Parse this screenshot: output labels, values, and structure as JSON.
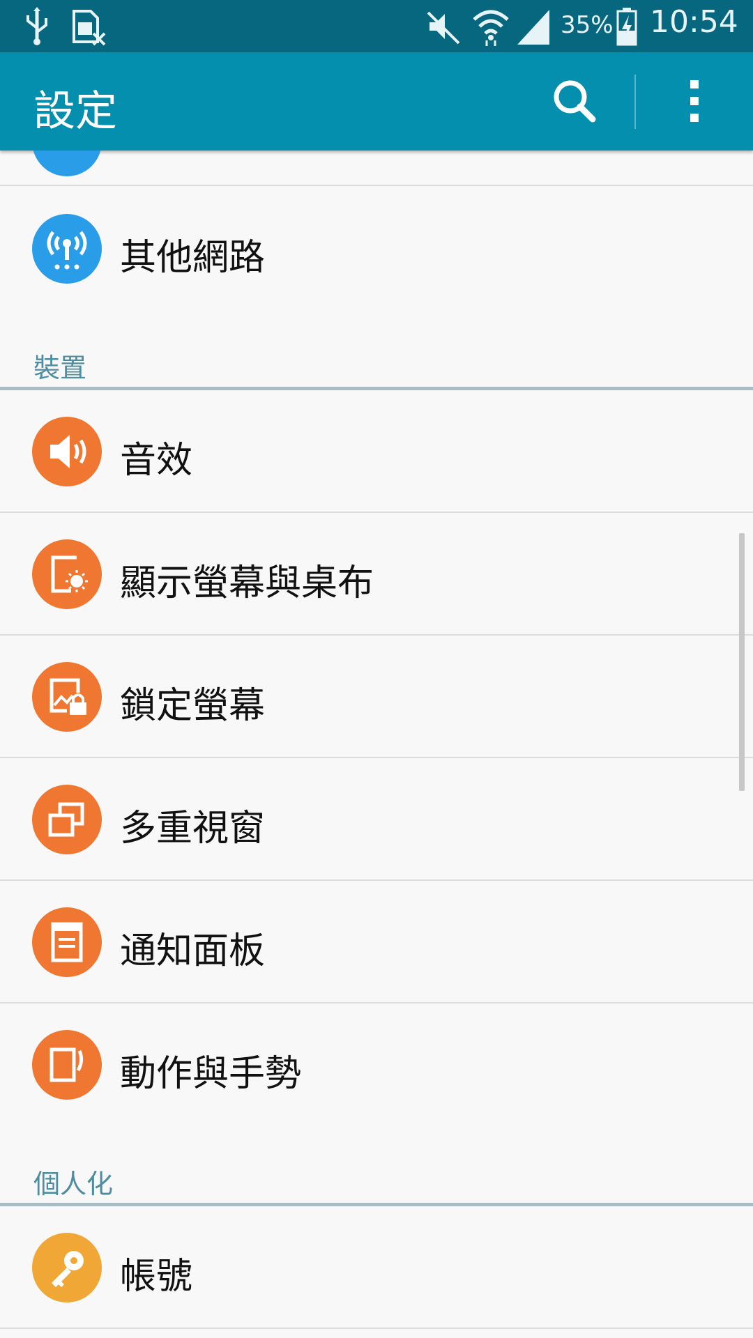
{
  "status_bar": {
    "battery_percent": "35%",
    "time": "10:54",
    "icons": [
      "usb-icon",
      "sim-card-off-icon",
      "mute-icon",
      "wifi-icon",
      "cell-signal-icon",
      "battery-charging-icon"
    ]
  },
  "app_bar": {
    "title": "設定",
    "icons": [
      "search-icon",
      "more-options-icon"
    ]
  },
  "list": {
    "rows_top": [
      {
        "label": "其他網路",
        "icon": "wireless-network-icon",
        "color": "#2a9de8"
      }
    ],
    "sections": [
      {
        "title": "裝置",
        "items": [
          {
            "label": "音效",
            "icon": "speaker-icon",
            "color": "#ef7732"
          },
          {
            "label": "顯示螢幕與桌布",
            "icon": "display-brightness-icon",
            "color": "#ef7732"
          },
          {
            "label": "鎖定螢幕",
            "icon": "lock-screen-icon",
            "color": "#ef7732"
          },
          {
            "label": "多重視窗",
            "icon": "multi-window-icon",
            "color": "#ef7732"
          },
          {
            "label": "通知面板",
            "icon": "notification-panel-icon",
            "color": "#ef7732"
          },
          {
            "label": "動作與手勢",
            "icon": "motion-gesture-icon",
            "color": "#ef7732"
          }
        ]
      },
      {
        "title": "個人化",
        "items": [
          {
            "label": "帳號",
            "icon": "key-icon",
            "color": "#f0a735"
          }
        ]
      }
    ]
  },
  "colors": {
    "status_bar": "#07677f",
    "app_bar": "#038fad",
    "background": "#f8f8f8",
    "section_title": "#4e8da0",
    "divider": "#d9dde0"
  }
}
